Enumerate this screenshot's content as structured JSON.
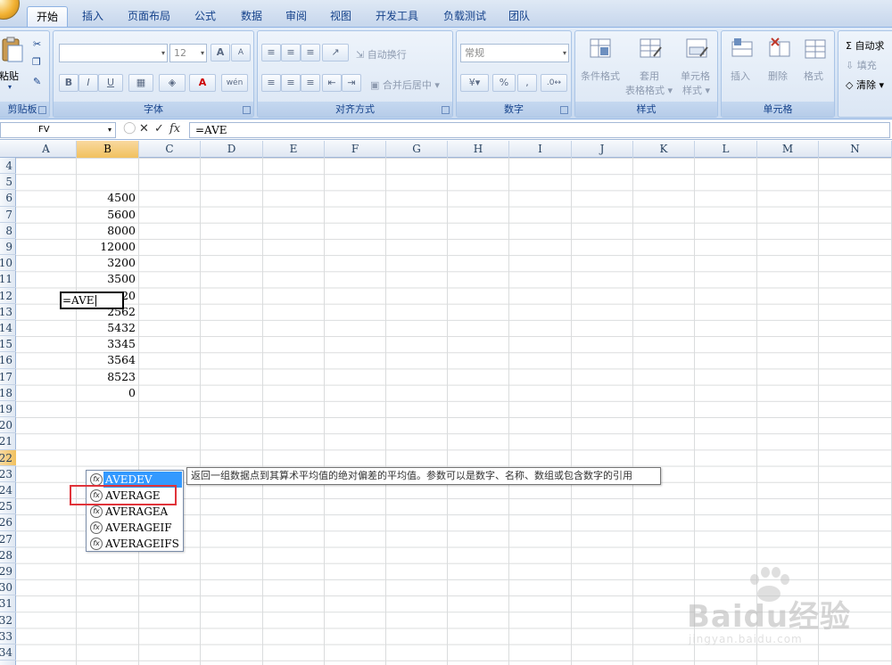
{
  "tabs": [
    {
      "label": "开始",
      "active": true
    },
    {
      "label": "插入"
    },
    {
      "label": "页面布局"
    },
    {
      "label": "公式"
    },
    {
      "label": "数据"
    },
    {
      "label": "审阅"
    },
    {
      "label": "视图"
    },
    {
      "label": "开发工具"
    },
    {
      "label": "负载测试"
    },
    {
      "label": "团队"
    }
  ],
  "ribbon": {
    "clipboard": {
      "title": "剪贴板",
      "paste": "粘贴"
    },
    "font": {
      "title": "字体",
      "size": "12",
      "bold": "B",
      "italic": "I",
      "underline": "U",
      "grow": "A",
      "shrink": "A",
      "font_color": "A",
      "phonetic": "wén"
    },
    "alignment": {
      "title": "对齐方式",
      "wrap_text": "自动换行",
      "merge_center": "合并后居中"
    },
    "number": {
      "title": "数字",
      "format": "常规",
      "percent": "%",
      "comma": ","
    },
    "styles": {
      "title": "样式",
      "conditional": "条件格式",
      "table_format": "套用",
      "table_format2": "表格格式",
      "cell_styles": "单元格",
      "cell_styles2": "样式"
    },
    "cells": {
      "title": "单元格",
      "insert": "插入",
      "delete": "删除",
      "format": "格式"
    },
    "editing": {
      "autosum": "Σ 自动求",
      "fill": "填充",
      "clear": "清除"
    }
  },
  "formula_bar": {
    "name_box": "FV",
    "formula": "=AVE"
  },
  "columns": [
    "A",
    "B",
    "C",
    "D",
    "E",
    "F",
    "G",
    "H",
    "I",
    "J",
    "K",
    "L",
    "M",
    "N"
  ],
  "rows": [
    "4",
    "5",
    "6",
    "7",
    "8",
    "9",
    "10",
    "11",
    "12",
    "13",
    "14",
    "15",
    "16",
    "17",
    "18",
    "19",
    "20",
    "21",
    "22",
    "23",
    "24",
    "25",
    "26",
    "27",
    "28",
    "29",
    "30",
    "31",
    "32",
    "33",
    "34"
  ],
  "cells_b": {
    "r6": "4500",
    "r7": "5600",
    "r8": "8000",
    "r9": "12000",
    "r10": "3200",
    "r11": "3500",
    "r12": "6420",
    "r13": "2562",
    "r14": "5432",
    "r15": "3345",
    "r16": "3564",
    "r17": "8523",
    "r18": "0"
  },
  "active_cell_text": "=AVE",
  "autocomplete": {
    "items": [
      "AVEDEV",
      "AVERAGE",
      "AVERAGEA",
      "AVERAGEIF",
      "AVERAGEIFS"
    ],
    "tooltip": "返回一组数据点到其算术平均值的绝对偏差的平均值。参数可以是数字、名称、数组或包含数字的引用",
    "fx": "fx"
  },
  "watermark": {
    "text": "Baidu经验",
    "url": "jingyan.baidu.com"
  },
  "colors": {
    "selected_blue": "#3399ff",
    "highlight_red": "#e0333a",
    "header_selected": "#f1c15f"
  }
}
